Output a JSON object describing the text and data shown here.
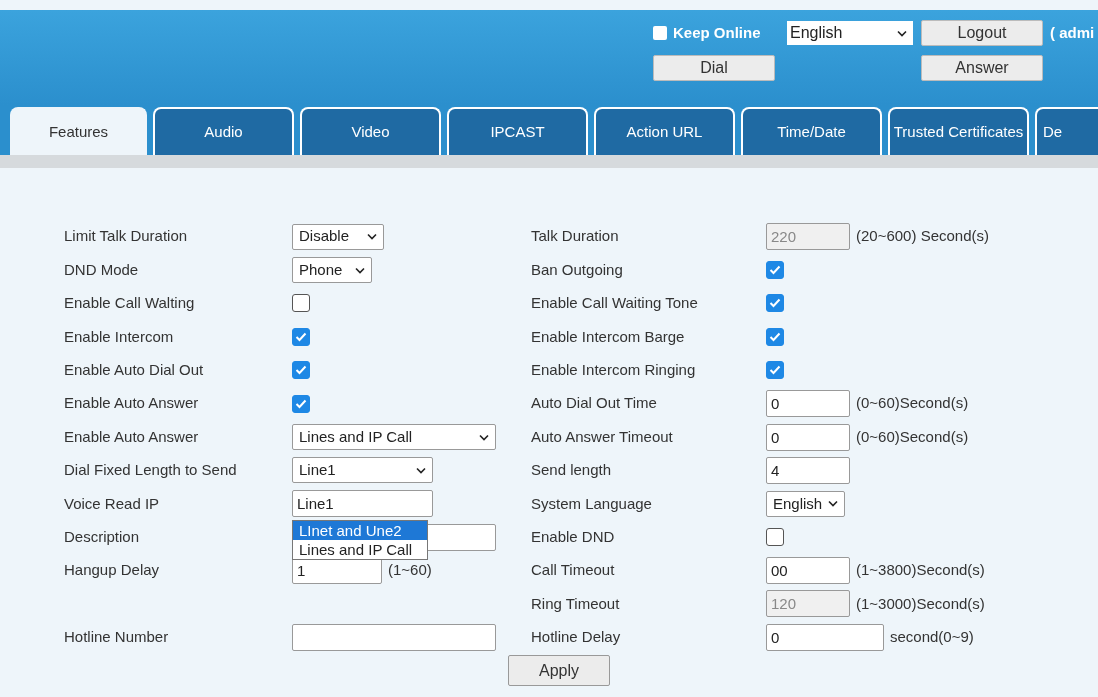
{
  "header": {
    "keep_online": {
      "label": "Keep Online",
      "checked": false
    },
    "language": "English",
    "buttons": [
      {
        "label": "Logout",
        "kind": "logout"
      },
      {
        "label": "Dial",
        "kind": "dial"
      },
      {
        "label": "Answer",
        "kind": "answer"
      }
    ],
    "user": "( admi"
  },
  "tabs": [
    {
      "label": "Features",
      "selected": true
    },
    {
      "label": "Audio",
      "selected": false
    },
    {
      "label": "Video",
      "selected": false
    },
    {
      "label": "IPCAST",
      "selected": false
    },
    {
      "label": "Action URL",
      "selected": false
    },
    {
      "label": "Time/Date",
      "selected": false
    },
    {
      "label": "Trusted Certificates",
      "selected": false
    },
    {
      "label": "De",
      "selected": false
    }
  ],
  "rows": [
    {
      "left": {
        "label": "Limit Talk Duration",
        "kind": "select",
        "value": "Disable"
      },
      "right": {
        "label": "Talk Duration",
        "kind": "text",
        "value": "220",
        "disabled": true,
        "suffix": "(20~600) Second(s)"
      }
    },
    {
      "left": {
        "label": "DND Mode",
        "kind": "select",
        "value": "Phone"
      },
      "right": {
        "label": "Ban Outgoing",
        "kind": "checkbox",
        "checked": true
      }
    },
    {
      "left": {
        "label": "Enable Call Walting",
        "kind": "checkbox",
        "checked": false
      },
      "right": {
        "label": "Enable Call Waiting Tone",
        "kind": "checkbox",
        "checked": true
      }
    },
    {
      "left": {
        "label": "Enable Intercom",
        "kind": "checkbox",
        "checked": true
      },
      "right": {
        "label": "Enable Intercom Barge",
        "kind": "checkbox",
        "checked": true
      }
    },
    {
      "left": {
        "label": "Enable Auto Dial Out",
        "kind": "checkbox",
        "checked": true
      },
      "right": {
        "label": "Enable Intercom Ringing",
        "kind": "checkbox",
        "checked": true
      }
    },
    {
      "left": {
        "label": "Enable Auto Answer",
        "kind": "checkbox",
        "checked": true
      },
      "right": {
        "label": "Auto Dial Out Time",
        "kind": "text",
        "value": "0",
        "suffix": "(0~60)Second(s)"
      }
    },
    {
      "left": {
        "label": "Enable Auto Answer",
        "kind": "select",
        "value": "Lines and IP Call"
      },
      "right": {
        "label": "Auto Answer Timeout",
        "kind": "text",
        "value": "0",
        "suffix": "(0~60)Second(s)"
      }
    },
    {
      "left": {
        "label": "Dial Fixed Length to Send",
        "kind": "select",
        "value": "Line1"
      },
      "right": {
        "label": "Send length",
        "kind": "text",
        "value": "4"
      }
    },
    {
      "left": {
        "label": "Voice Read IP",
        "kind": "text",
        "value": "Line1"
      },
      "right": {
        "label": "System Language",
        "kind": "select",
        "value": "English"
      }
    },
    {
      "left": {
        "label": "Description",
        "kind": "text",
        "popup_list": [
          {
            "label": "LInet and Une2",
            "selected": true
          },
          {
            "label": "Lines and IP Call",
            "selected": false
          }
        ]
      },
      "right": {
        "label": "Enable DND",
        "kind": "checkbox",
        "checked": false
      }
    },
    {
      "left": {
        "label": "Hangup Delay",
        "kind": "text",
        "value": "1",
        "suffix": "(1~60)"
      },
      "right": {
        "label": "Call Timeout",
        "kind": "text",
        "value": "00",
        "suffix": "(1~3800)Second(s)"
      }
    },
    {
      "right": {
        "label": "Ring Timeout",
        "kind": "text",
        "value": "120",
        "disabled": true,
        "suffix": "(1~3000)Second(s)"
      }
    },
    {
      "left": {
        "label": "Hotline Number",
        "kind": "text"
      },
      "right": {
        "label": "Hotline Delay",
        "kind": "text",
        "value": "0",
        "suffix": "second(0~9)"
      }
    }
  ],
  "apply": "Apply"
}
